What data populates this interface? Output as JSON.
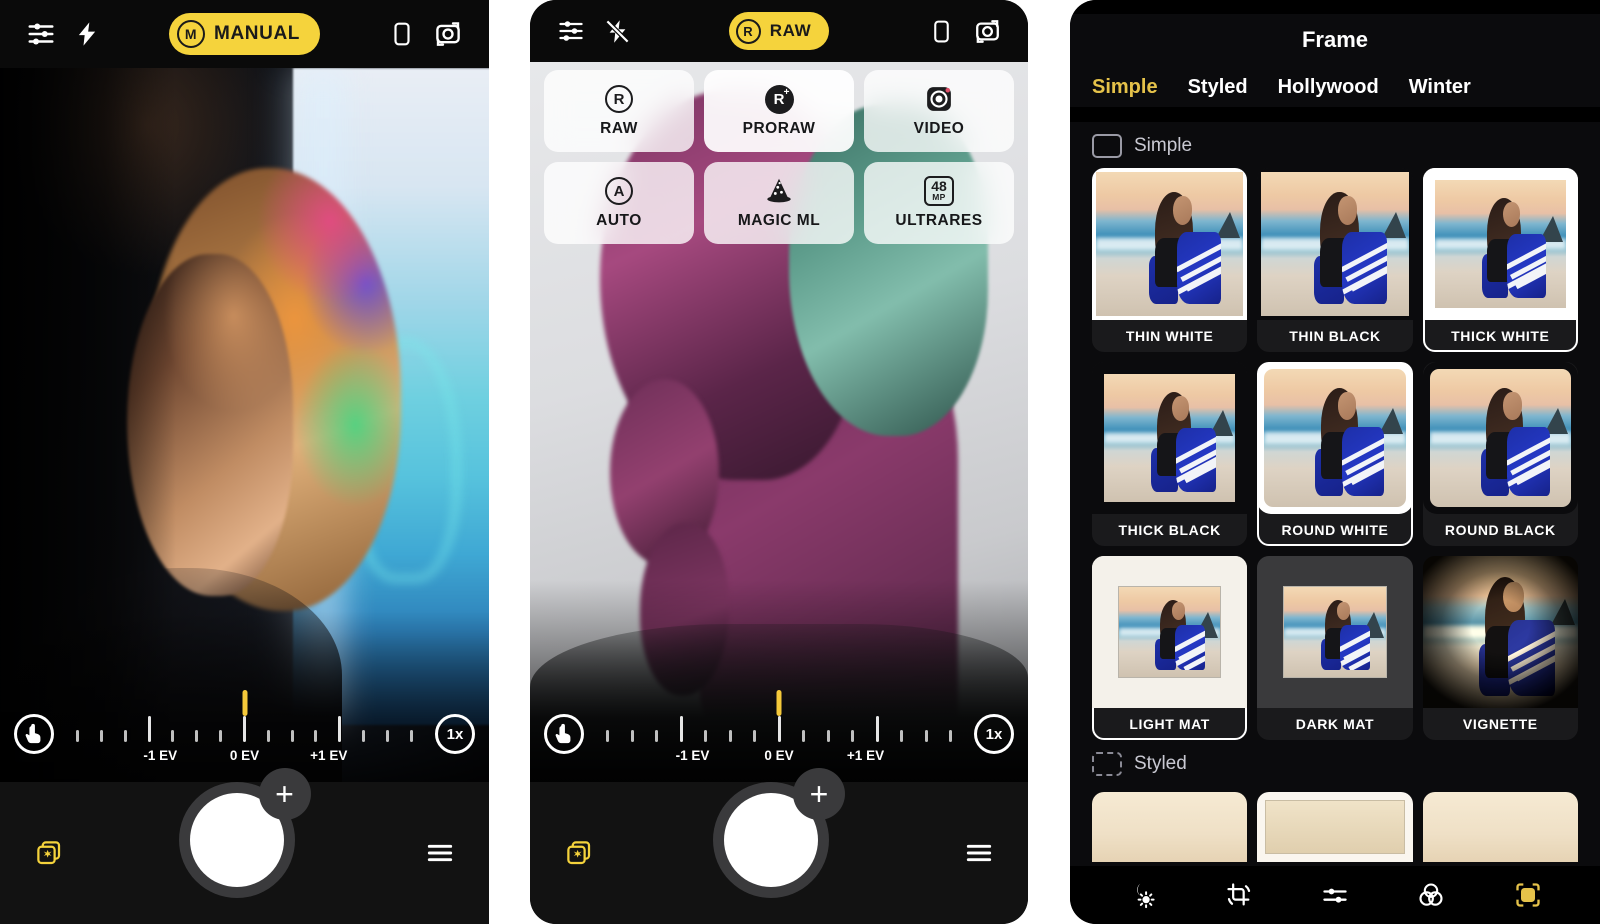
{
  "panel1": {
    "topbar": {
      "settings_icon": "sliders-icon",
      "flash_icon": "flash-on-icon",
      "mode_badge": "M",
      "mode_label": "MANUAL",
      "aspect_icon": "portrait-aspect-icon",
      "flip_icon": "flip-camera-icon"
    },
    "ev": {
      "left_icon": "touch-focus-icon",
      "zoom_label": "1x",
      "labels": [
        "-1 EV",
        "0 EV",
        "+1 EV"
      ],
      "marker_color": "#f5c93a",
      "value": "0 EV"
    },
    "shutter": {
      "gallery_icon": "gallery-stack-icon",
      "plus_label": "+",
      "menu_icon": "hamburger-menu-icon"
    }
  },
  "panel2": {
    "topbar": {
      "settings_icon": "sliders-icon",
      "flash_icon": "flash-off-icon",
      "mode_badge": "R",
      "mode_label": "RAW",
      "aspect_icon": "portrait-aspect-icon",
      "flip_icon": "flip-camera-icon"
    },
    "modes": [
      {
        "label": "RAW",
        "icon": "raw-ring-icon",
        "badge": "R",
        "selected": false,
        "style": "ring"
      },
      {
        "label": "PRORAW",
        "icon": "proraw-icon",
        "badge": "R",
        "selected": true,
        "style": "solid"
      },
      {
        "label": "VIDEO",
        "icon": "video-camera-icon",
        "badge": "",
        "selected": false,
        "style": "video"
      },
      {
        "label": "AUTO",
        "icon": "auto-ring-icon",
        "badge": "A",
        "selected": false,
        "style": "ring"
      },
      {
        "label": "MAGIC ML",
        "icon": "wizard-hat-icon",
        "badge": "",
        "selected": false,
        "style": "hat"
      },
      {
        "label": "ULTRARES",
        "icon": "megapixel-icon",
        "badge": "48",
        "badge_sub": "MP",
        "selected": false,
        "style": "mp"
      }
    ],
    "ev": {
      "left_icon": "touch-focus-icon",
      "zoom_label": "1x",
      "labels": [
        "-1 EV",
        "0 EV",
        "+1 EV"
      ],
      "marker_color": "#f5c93a",
      "value": "0 EV"
    },
    "shutter": {
      "gallery_icon": "gallery-stack-icon",
      "plus_label": "+",
      "menu_icon": "hamburger-menu-icon"
    }
  },
  "panel3": {
    "title": "Frame",
    "accent_color": "#e5c24a",
    "tabs": [
      {
        "label": "Simple",
        "active": true
      },
      {
        "label": "Styled",
        "active": false
      },
      {
        "label": "Hollywood",
        "active": false
      },
      {
        "label": "Winter",
        "active": false
      }
    ],
    "sections": [
      {
        "title": "Simple",
        "icon": "frame-square-icon",
        "frames": [
          {
            "label": "THIN WHITE",
            "variant": "fr-thin-white",
            "selected": false
          },
          {
            "label": "THIN BLACK",
            "variant": "fr-thin-black",
            "selected": false
          },
          {
            "label": "THICK WHITE",
            "variant": "fr-thick-white",
            "selected": true
          },
          {
            "label": "THICK BLACK",
            "variant": "fr-thick-black",
            "selected": false
          },
          {
            "label": "ROUND WHITE",
            "variant": "fr-round-white",
            "selected": true
          },
          {
            "label": "ROUND BLACK",
            "variant": "fr-round-black",
            "selected": false
          },
          {
            "label": "LIGHT MAT",
            "variant": "fr-light-mat",
            "selected": true
          },
          {
            "label": "DARK MAT",
            "variant": "fr-dark-mat",
            "selected": false
          },
          {
            "label": "VIGNETTE",
            "variant": "fr-vignette",
            "selected": false
          }
        ]
      },
      {
        "title": "Styled",
        "icon": "frame-dashed-icon",
        "frames": []
      }
    ],
    "bottombar": [
      {
        "icon": "exposure-moon-sun-icon",
        "active": false
      },
      {
        "icon": "crop-rotate-icon",
        "active": false
      },
      {
        "icon": "adjust-sliders-icon",
        "active": false
      },
      {
        "icon": "color-circles-icon",
        "active": false
      },
      {
        "icon": "frame-corners-icon",
        "active": true
      }
    ]
  }
}
